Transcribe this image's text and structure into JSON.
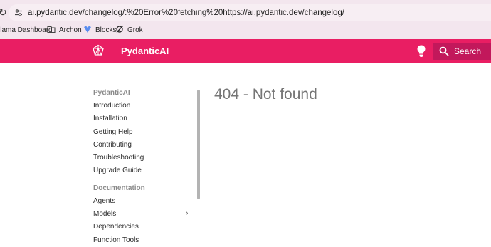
{
  "browser": {
    "url_domain": "ai.pydantic.dev",
    "url_path": "/changelog/:%20Error%20fetching%20https://ai.pydantic.dev/changelog/",
    "bookmarks": [
      {
        "label": "llama Dashboard",
        "icon": "none"
      },
      {
        "label": "Archon",
        "icon": "folder-icon"
      },
      {
        "label": "Blocksi",
        "icon": "blocksi-icon"
      },
      {
        "label": "Grok",
        "icon": "grok-icon"
      }
    ]
  },
  "header": {
    "title": "PydanticAI",
    "search_label": "Search",
    "accent": "#e91e63",
    "search_bg": "#c2185b"
  },
  "nav": {
    "section1": "PydanticAI",
    "items1": [
      "Introduction",
      "Installation",
      "Getting Help",
      "Contributing",
      "Troubleshooting",
      "Upgrade Guide"
    ],
    "section2": "Documentation",
    "items2": [
      "Agents",
      "Models",
      "Dependencies",
      "Function Tools"
    ],
    "models_chevron": "›"
  },
  "main": {
    "heading": "404 - Not found"
  }
}
